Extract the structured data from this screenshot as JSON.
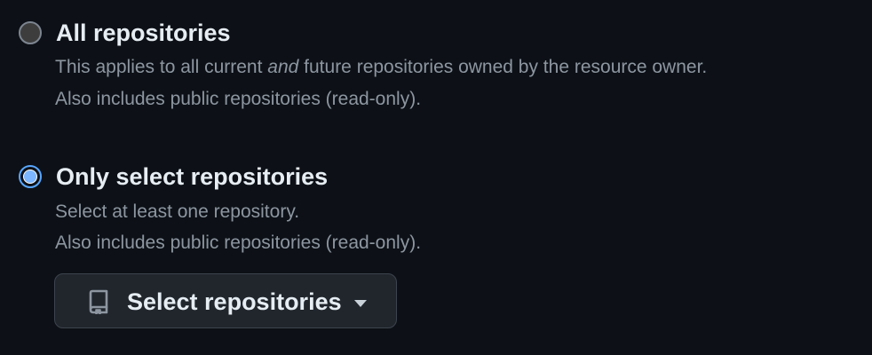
{
  "options": [
    {
      "label": "All repositories",
      "selected": false,
      "description_before": "This applies to all current ",
      "description_emphasis": "and",
      "description_after": " future repositories owned by the resource owner.",
      "note": "Also includes public repositories (read-only)."
    },
    {
      "label": "Only select repositories",
      "selected": true,
      "description": "Select at least one repository.",
      "note": "Also includes public repositories (read-only).",
      "button": {
        "label": "Select repositories",
        "icon": "repo-icon",
        "caret": "caret-down-icon"
      }
    }
  ],
  "colors": {
    "background": "#0d1117",
    "text": "#e6edf3",
    "muted": "#8d96a0",
    "accent": "#58a6ff",
    "button_bg": "#21262d",
    "button_border": "#3d444d"
  }
}
